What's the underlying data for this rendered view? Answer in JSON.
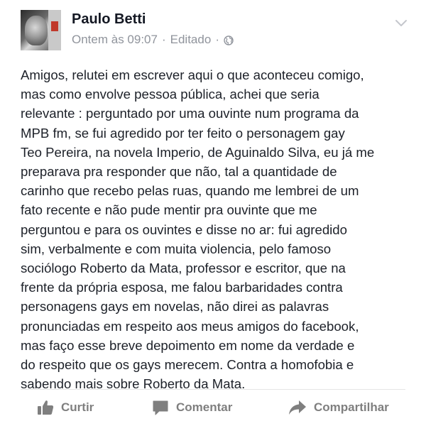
{
  "post": {
    "author": "Paulo Betti",
    "timestamp": "Ontem às 09:07",
    "edited": "Editado",
    "separator": "·",
    "body_lines": [
      "Amigos, relutei em escrever aqui o que aconteceu comigo,",
      "mas como envolve pessoa pública, achei que seria",
      "relevante : perguntado por uma ouvinte num programa da",
      "MPB fm, se fui agredido por ter feito o personagem gay",
      "Teo Pereira, na novela Imperio, de Aguinaldo Silva, eu já me",
      "preparava pra responder que não, tal a quantidade de",
      "carinho que recebo pelas ruas, quando me lembrei de um",
      "fato recente e não pude mentir pra ouvinte que me",
      "perguntou e para os ouvintes e disse no ar: fui agredido",
      "sim, verbalmente e com muita violencia, pelo famoso",
      "sociólogo Roberto da Mata, professor e escritor, que na",
      "frente da própria esposa, me falou barbaridades contra",
      "personagens gays em novelas, não direi as palavras",
      "pronunciadas em respeito aos meus amigos do facebook,",
      "mas faço esse breve depoimento em nome da verdade e",
      "do respeito que os gays merecem. Contra a homofobia e",
      "sabendo mais sobre Roberto da Mata."
    ],
    "privacy_icon": "globe-icon",
    "menu_icon": "chevron-down-icon"
  },
  "actions": {
    "like": {
      "label": "Curtir",
      "icon": "thumbs-up-icon"
    },
    "comment": {
      "label": "Comentar",
      "icon": "comment-icon"
    },
    "share": {
      "label": "Compartilhar",
      "icon": "share-arrow-icon"
    }
  },
  "colors": {
    "author": "#141823",
    "meta": "#90949c",
    "body": "#1d2129",
    "action": "#7f7f7f"
  }
}
